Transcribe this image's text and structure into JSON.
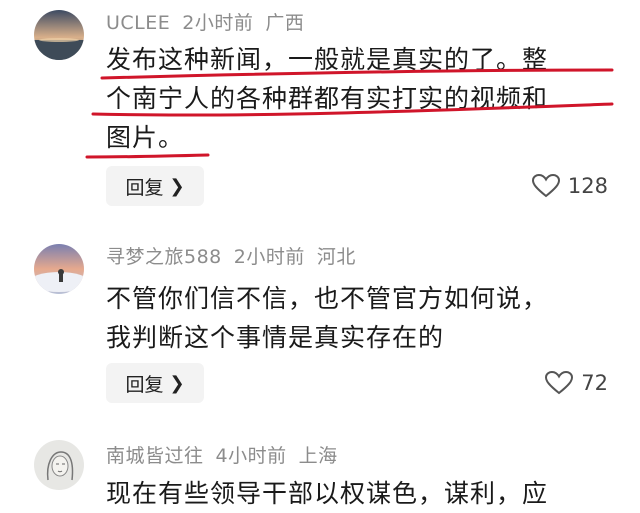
{
  "comments": [
    {
      "username": "UCLEE",
      "time": "2小时前",
      "location": "广西",
      "lines": [
        "发布这种新闻，一般就是真实的了。整",
        "个南宁人的各种群都有实打实的视频和",
        "图片。"
      ],
      "reply_label": "回复",
      "likes": "128",
      "avatar": "avatar-sunset-lake"
    },
    {
      "username": "寻梦之旅588",
      "time": "2小时前",
      "location": "河北",
      "lines": [
        "不管你们信不信，也不管官方如何说，",
        "我判断这个事情是真实存在的"
      ],
      "reply_label": "回复",
      "likes": "72",
      "avatar": "avatar-person-clouds"
    },
    {
      "username": "南城皆过往",
      "time": "4小时前",
      "location": "上海",
      "lines": [
        "现在有些领导干部以权谋色，谋利，应"
      ],
      "avatar": "avatar-sketch-girl"
    }
  ],
  "icons": {
    "like": "heart-icon",
    "reply_chevron": "chevron-right-icon"
  },
  "colors": {
    "annotation_red": "#d0152a",
    "meta_gray": "#8c8c8c",
    "button_bg": "#f3f3f3"
  }
}
